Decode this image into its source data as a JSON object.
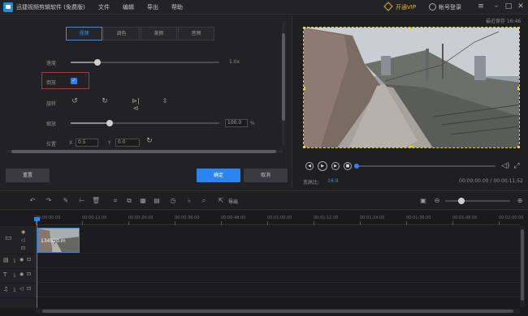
{
  "app": {
    "title": "迅捷视频剪辑软件 (免费版)",
    "menu": [
      "文件",
      "编辑",
      "导出",
      "帮助"
    ],
    "vip": "开通VIP",
    "login": "帐号登录",
    "autosave": "最近保存 16:46"
  },
  "left_panel": {
    "tabs": [
      {
        "label": "视频",
        "active": true
      },
      {
        "label": "调色",
        "active": false
      },
      {
        "label": "美颜",
        "active": false
      },
      {
        "label": "音频",
        "active": false
      }
    ],
    "speed": {
      "label": "速度",
      "value": "1.0x",
      "level": 0.18
    },
    "reverse": {
      "label": "倒放",
      "checked": true
    },
    "rotate": {
      "label": "旋转"
    },
    "scale": {
      "label": "缩放",
      "value": "100.0",
      "unit": "%",
      "level": 0.26
    },
    "position": {
      "label": "位置",
      "x_label": "X",
      "x_value": "0.5",
      "y_label": "Y",
      "y_value": "0.0"
    },
    "reset_label": "重置",
    "ok_label": "确定",
    "cancel_label": "取消"
  },
  "preview": {
    "aspect_label": "宽高比:",
    "aspect_value": "16:9",
    "time": "00:00:00.00 / 00:00:11.52"
  },
  "toolbar": {
    "export_label": "导出"
  },
  "timeline": {
    "ruler": [
      "00:00:00.00",
      "00:00:12.00",
      "00:00:24.00",
      "00:00:36.00",
      "00:00:48.00",
      "00:01:00.00",
      "00:01:12.00",
      "00:01:24.00",
      "00:01:36.00",
      "00:01:48.00",
      "00:02:00.00"
    ],
    "clip_label": "134520.m",
    "track_nums": [
      "1",
      "1",
      "1"
    ]
  },
  "colors": {
    "accent": "#2b85f0",
    "highlight_box": "#e02020",
    "vip": "#e6b030"
  }
}
